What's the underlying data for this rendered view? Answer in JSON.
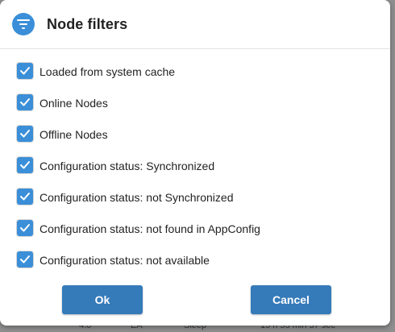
{
  "dialog": {
    "title": "Node filters",
    "icon": "filter-icon",
    "accent_color": "#3a8fd8",
    "button_color": "#357ab9"
  },
  "filters": [
    {
      "label": "Loaded from system cache",
      "checked": true
    },
    {
      "label": "Online Nodes",
      "checked": true
    },
    {
      "label": "Offline Nodes",
      "checked": true
    },
    {
      "label": "Configuration status: Synchronized",
      "checked": true
    },
    {
      "label": "Configuration status: not Synchronized",
      "checked": true
    },
    {
      "label": "Configuration status: not found in AppConfig",
      "checked": true
    },
    {
      "label": "Configuration status: not available",
      "checked": true
    }
  ],
  "buttons": {
    "ok_label": "Ok",
    "cancel_label": "Cancel"
  },
  "background": {
    "row_cells": [
      "4.0",
      "EA",
      "Sleep",
      "15 h 55 min 37 sec"
    ]
  }
}
